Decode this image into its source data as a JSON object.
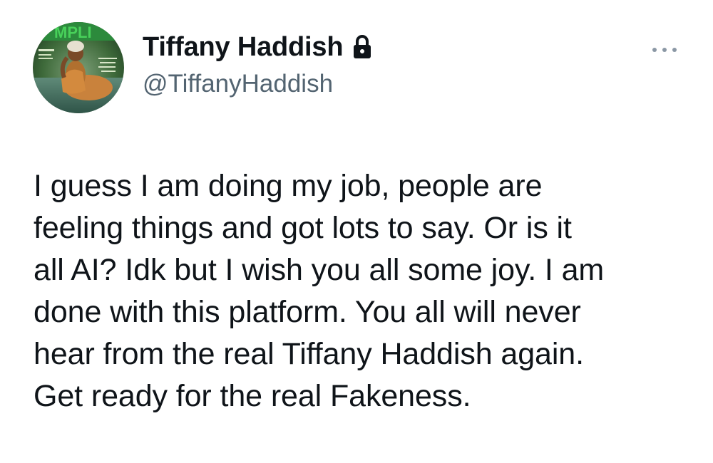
{
  "author": {
    "display_name": "Tiffany Haddish",
    "handle": "@TiffanyHaddish",
    "protected_icon": "lock-icon",
    "avatar_icon": "profile-photo-avatar"
  },
  "menu": {
    "icon": "more-options-icon"
  },
  "tweet": {
    "text": "I guess I am doing my job, people are\nfeeling things and got lots to say. Or is it\nall AI? Idk but I wish you all some joy. I am\ndone with this platform. You all will never\nhear from the real Tiffany Haddish again.\nGet ready for the real Fakeness."
  },
  "colors": {
    "text_primary": "#0f1419",
    "text_secondary": "#536471",
    "background": "#ffffff"
  }
}
